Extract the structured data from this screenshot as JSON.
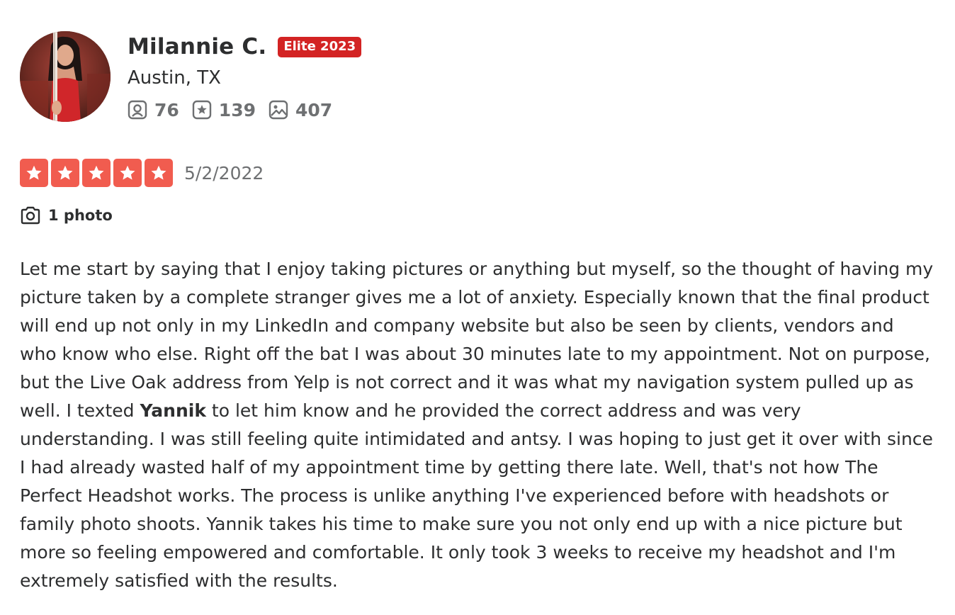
{
  "user": {
    "name": "Milannie C.",
    "elite_badge": "Elite 2023",
    "location": "Austin, TX",
    "stats": {
      "friends": "76",
      "reviews": "139",
      "photos": "407"
    }
  },
  "review": {
    "rating": 5,
    "rating_max": 5,
    "date": "5/2/2022",
    "photo_label": "1 photo",
    "text_part1": "Let me start by saying that I enjoy taking pictures or anything but myself, so the thought of having my picture taken by a complete stranger gives me a lot of anxiety. Especially known that the final product will end up not only in my LinkedIn and company website but also be seen by clients, vendors and who know who else. Right off the bat I was about 30 minutes late to my appointment. Not on purpose, but the Live Oak address from Yelp is not correct and it was what my navigation system pulled up as well. I texted ",
    "text_bold": "Yannik",
    "text_part2": " to let him know and he provided the correct address and was very understanding. I was still feeling quite intimidated and antsy. I was hoping to just get it over with since I had already wasted half of my appointment time by getting there late. Well, that's not how The Perfect Headshot works. The process is unlike anything I've experienced before with headshots or family photo shoots. Yannik takes his time to make sure you not only end up with a nice picture but more so feeling empowered and comfortable. It only took 3 weeks to receive my headshot and I'm extremely satisfied with the results."
  },
  "colors": {
    "elite": "#d32323",
    "star_bg": "#f15c4f",
    "text": "#2d2e2f",
    "muted": "#6e7072"
  },
  "icons": {
    "friends": "friends-icon",
    "reviews": "review-star-icon",
    "photos": "photos-icon",
    "camera": "camera-icon",
    "star": "star-icon"
  }
}
